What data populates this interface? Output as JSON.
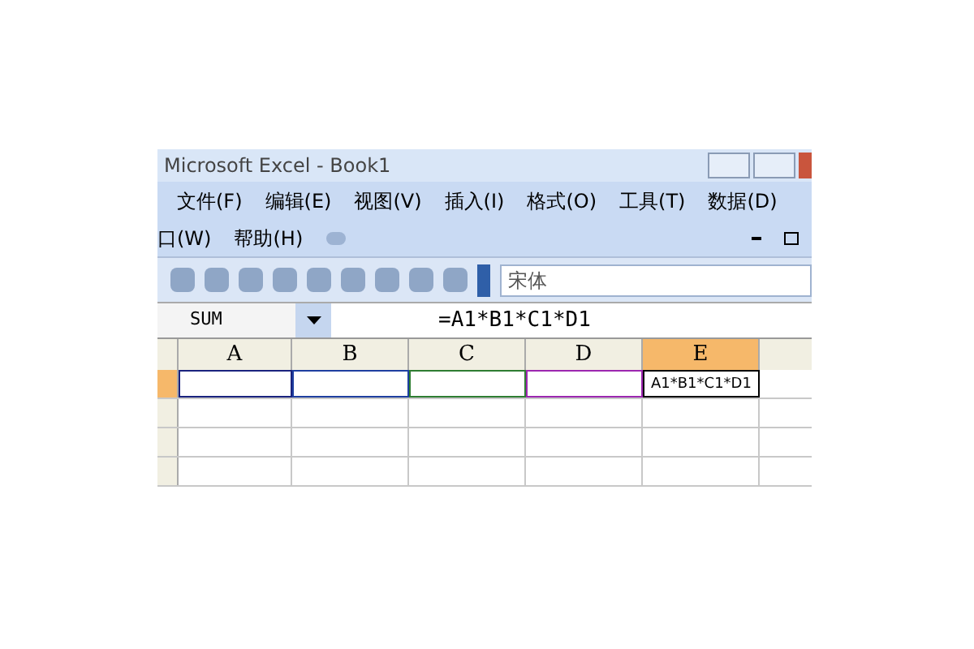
{
  "window": {
    "title": "Microsoft Excel - Book1"
  },
  "menu_bar": [
    {
      "label": "文件(F)"
    },
    {
      "label": "编辑(E)"
    },
    {
      "label": "视图(V)"
    },
    {
      "label": "插入(I)"
    },
    {
      "label": "格式(O)"
    },
    {
      "label": "工具(T)"
    },
    {
      "label": "数据(D)"
    }
  ],
  "menu_bar_2": [
    {
      "label": "口(W)"
    },
    {
      "label": "帮助(H)"
    }
  ],
  "toolbar": {
    "font": "宋体"
  },
  "formula_bar": {
    "name_box": "SUM",
    "formula": "=A1*B1*C1*D1"
  },
  "columns": [
    {
      "label": "A",
      "selected": false
    },
    {
      "label": "B",
      "selected": false
    },
    {
      "label": "C",
      "selected": false
    },
    {
      "label": "D",
      "selected": false
    },
    {
      "label": "E",
      "selected": true
    }
  ],
  "rows": [
    {
      "selected": true
    },
    {
      "selected": false
    },
    {
      "selected": false
    },
    {
      "selected": false
    }
  ],
  "ranges": [
    {
      "color": "#1a237e"
    },
    {
      "color": "#1e3fa0"
    },
    {
      "color": "#2e7d32"
    },
    {
      "color": "#9c27b0"
    }
  ],
  "edit_cell": {
    "text": "A1*B1*C1*D1"
  }
}
